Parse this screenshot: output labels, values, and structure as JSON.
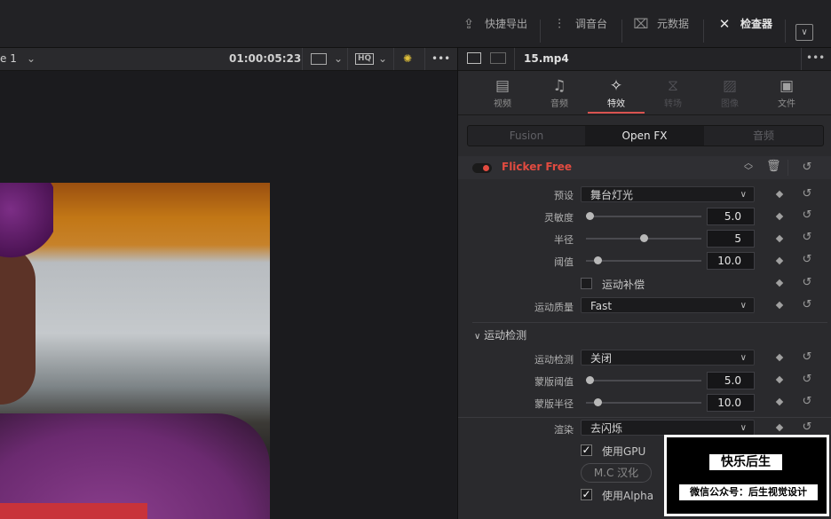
{
  "topbar": {
    "quick_export": "快捷导出",
    "mixer": "调音台",
    "metadata": "元数据",
    "inspector": "检查器",
    "icons": [
      "upload-icon",
      "sliders-icon",
      "tag-icon",
      "tools-icon",
      "expand-icon"
    ]
  },
  "viewer": {
    "timeline_name": "e 1",
    "timecode": "01:00:05:23",
    "more": "•••"
  },
  "inspector": {
    "clip_name": "15.mp4",
    "more": "•••",
    "tabs": [
      {
        "label": "视频",
        "icon": "film-icon",
        "enabled": true
      },
      {
        "label": "音频",
        "icon": "music-note-icon",
        "enabled": true
      },
      {
        "label": "特效",
        "icon": "magic-wand-icon",
        "enabled": true,
        "active": true
      },
      {
        "label": "转场",
        "icon": "transition-icon",
        "enabled": false
      },
      {
        "label": "图像",
        "icon": "image-icon",
        "enabled": false
      },
      {
        "label": "文件",
        "icon": "file-icon",
        "enabled": true
      }
    ],
    "subtabs": [
      "Fusion",
      "Open FX",
      "音频"
    ],
    "subtab_active": "Open FX",
    "effect": {
      "name": "Flicker Free",
      "accent": "#e24b40",
      "preset_label": "预设",
      "preset_value": "舞台灯光",
      "sensitivity_label": "灵敏度",
      "sensitivity_value": "5.0",
      "sensitivity_level": 0.03,
      "radius_label": "半径",
      "radius_value": "5",
      "radius_level": 0.5,
      "threshold_label": "阈值",
      "threshold_value": "10.0",
      "threshold_level": 0.1,
      "motion_comp_label": "运动补偿",
      "motion_comp_checked": false,
      "motion_quality_label": "运动质量",
      "motion_quality_value": "Fast",
      "motion_detect_group": "运动检测",
      "motion_detect_label": "运动检测",
      "motion_detect_value": "关闭",
      "mask_threshold_label": "蒙版阈值",
      "mask_threshold_value": "5.0",
      "mask_threshold_level": 0.03,
      "mask_radius_label": "蒙版半径",
      "mask_radius_value": "10.0",
      "mask_radius_level": 0.1,
      "render_label": "渲染",
      "render_value": "去闪烁",
      "use_gpu_label": "使用GPU",
      "use_gpu_checked": true,
      "mc_button": "M.C 汉化",
      "use_alpha_label": "使用Alpha",
      "use_alpha_checked": true
    }
  },
  "watermark": {
    "title": "快乐后生",
    "subtitle": "微信公众号：后生视觉设计"
  }
}
